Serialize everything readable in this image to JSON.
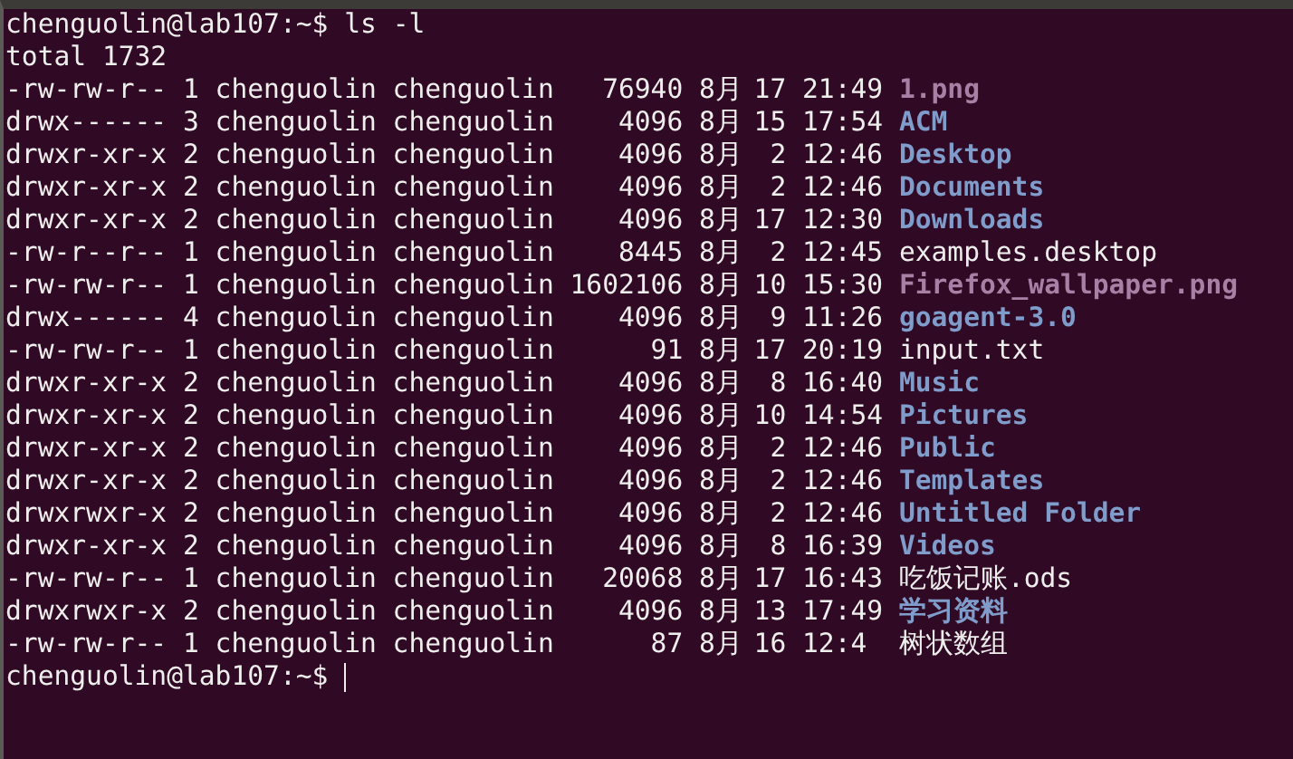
{
  "command_line": {
    "prompt": "chenguolin@lab107:~$",
    "command": "ls -l"
  },
  "total": "total 1732",
  "entries": [
    {
      "perms": "-rw-rw-r--",
      "links": "1",
      "owner": "chenguolin",
      "group": "chenguolin",
      "size": "76940",
      "month": "8月",
      "day": "17",
      "time": "21:49",
      "name": "1.png",
      "kind": "image"
    },
    {
      "perms": "drwx------",
      "links": "3",
      "owner": "chenguolin",
      "group": "chenguolin",
      "size": "4096",
      "month": "8月",
      "day": "15",
      "time": "17:54",
      "name": "ACM",
      "kind": "dir"
    },
    {
      "perms": "drwxr-xr-x",
      "links": "2",
      "owner": "chenguolin",
      "group": "chenguolin",
      "size": "4096",
      "month": "8月",
      "day": "2",
      "time": "12:46",
      "name": "Desktop",
      "kind": "dir"
    },
    {
      "perms": "drwxr-xr-x",
      "links": "2",
      "owner": "chenguolin",
      "group": "chenguolin",
      "size": "4096",
      "month": "8月",
      "day": "2",
      "time": "12:46",
      "name": "Documents",
      "kind": "dir"
    },
    {
      "perms": "drwxr-xr-x",
      "links": "2",
      "owner": "chenguolin",
      "group": "chenguolin",
      "size": "4096",
      "month": "8月",
      "day": "17",
      "time": "12:30",
      "name": "Downloads",
      "kind": "dir"
    },
    {
      "perms": "-rw-r--r--",
      "links": "1",
      "owner": "chenguolin",
      "group": "chenguolin",
      "size": "8445",
      "month": "8月",
      "day": "2",
      "time": "12:45",
      "name": "examples.desktop",
      "kind": "file"
    },
    {
      "perms": "-rw-rw-r--",
      "links": "1",
      "owner": "chenguolin",
      "group": "chenguolin",
      "size": "1602106",
      "month": "8月",
      "day": "10",
      "time": "15:30",
      "name": "Firefox_wallpaper.png",
      "kind": "image"
    },
    {
      "perms": "drwx------",
      "links": "4",
      "owner": "chenguolin",
      "group": "chenguolin",
      "size": "4096",
      "month": "8月",
      "day": "9",
      "time": "11:26",
      "name": "goagent-3.0",
      "kind": "dir"
    },
    {
      "perms": "-rw-rw-r--",
      "links": "1",
      "owner": "chenguolin",
      "group": "chenguolin",
      "size": "91",
      "month": "8月",
      "day": "17",
      "time": "20:19",
      "name": "input.txt",
      "kind": "file"
    },
    {
      "perms": "drwxr-xr-x",
      "links": "2",
      "owner": "chenguolin",
      "group": "chenguolin",
      "size": "4096",
      "month": "8月",
      "day": "8",
      "time": "16:40",
      "name": "Music",
      "kind": "dir"
    },
    {
      "perms": "drwxr-xr-x",
      "links": "2",
      "owner": "chenguolin",
      "group": "chenguolin",
      "size": "4096",
      "month": "8月",
      "day": "10",
      "time": "14:54",
      "name": "Pictures",
      "kind": "dir"
    },
    {
      "perms": "drwxr-xr-x",
      "links": "2",
      "owner": "chenguolin",
      "group": "chenguolin",
      "size": "4096",
      "month": "8月",
      "day": "2",
      "time": "12:46",
      "name": "Public",
      "kind": "dir"
    },
    {
      "perms": "drwxr-xr-x",
      "links": "2",
      "owner": "chenguolin",
      "group": "chenguolin",
      "size": "4096",
      "month": "8月",
      "day": "2",
      "time": "12:46",
      "name": "Templates",
      "kind": "dir"
    },
    {
      "perms": "drwxrwxr-x",
      "links": "2",
      "owner": "chenguolin",
      "group": "chenguolin",
      "size": "4096",
      "month": "8月",
      "day": "2",
      "time": "12:46",
      "name": "Untitled Folder",
      "kind": "dir"
    },
    {
      "perms": "drwxr-xr-x",
      "links": "2",
      "owner": "chenguolin",
      "group": "chenguolin",
      "size": "4096",
      "month": "8月",
      "day": "8",
      "time": "16:39",
      "name": "Videos",
      "kind": "dir"
    },
    {
      "perms": "-rw-rw-r--",
      "links": "1",
      "owner": "chenguolin",
      "group": "chenguolin",
      "size": "20068",
      "month": "8月",
      "day": "17",
      "time": "16:43",
      "name": "吃饭记账.ods",
      "kind": "file"
    },
    {
      "perms": "drwxrwxr-x",
      "links": "2",
      "owner": "chenguolin",
      "group": "chenguolin",
      "size": "4096",
      "month": "8月",
      "day": "13",
      "time": "17:49",
      "name": "学习资料",
      "kind": "dir"
    },
    {
      "perms": "-rw-rw-r--",
      "links": "1",
      "owner": "chenguolin",
      "group": "chenguolin",
      "size": "87",
      "month": "8月",
      "day": "16",
      "time": "12:4",
      "name": "树状数组",
      "kind": "file"
    }
  ],
  "prompt_line": {
    "prompt": "chenguolin@lab107:~$"
  }
}
